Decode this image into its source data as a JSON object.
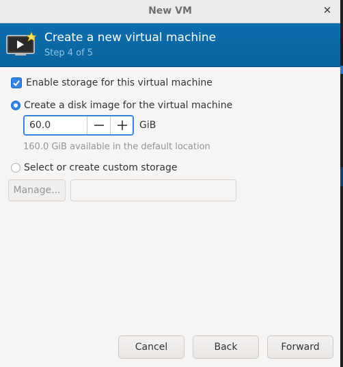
{
  "window": {
    "title": "New VM",
    "close_glyph": "✕"
  },
  "header": {
    "title": "Create a new virtual machine",
    "step": "Step 4 of 5",
    "icon": "vm-monitor-play-star-icon",
    "background_color": "#0a66a4"
  },
  "storage": {
    "enable_label": "Enable storage for this virtual machine",
    "enable_checked": true,
    "disk_image_label": "Create a disk image for the virtual machine",
    "disk_image_selected": true,
    "disk_size_value": "60.0",
    "decrement_glyph": "—",
    "increment_glyph": "+",
    "unit": "GiB",
    "available_text": "160.0 GiB available in the default location",
    "custom_label": "Select or create custom storage",
    "custom_selected": false,
    "manage_label": "Manage...",
    "custom_path_value": ""
  },
  "footer": {
    "cancel_label": "Cancel",
    "back_label": "Back",
    "forward_label": "Forward"
  },
  "colors": {
    "accent": "#3584e4",
    "header_bg": "#0a66a4",
    "window_bg": "#f6f5f4"
  }
}
